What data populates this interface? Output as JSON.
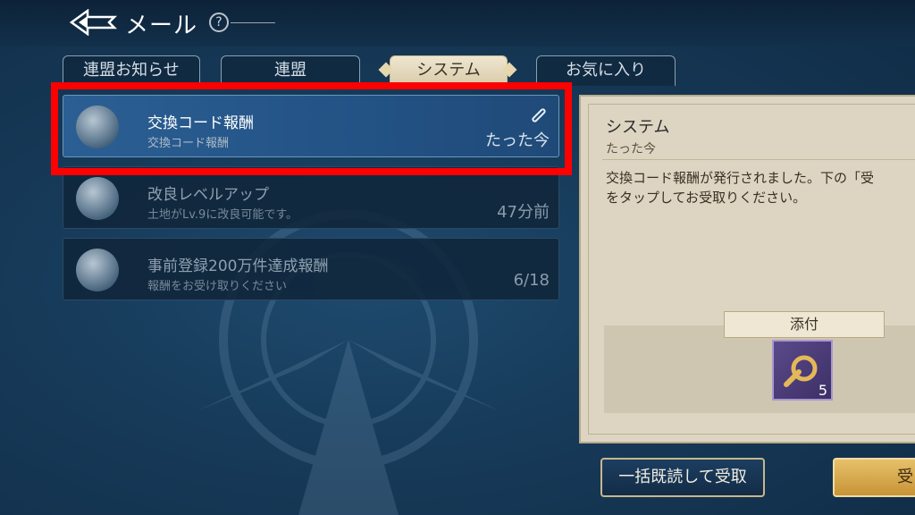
{
  "header": {
    "title": "メール",
    "help_label": "?"
  },
  "tabs": [
    {
      "label": "連盟お知らせ",
      "active": false
    },
    {
      "label": "連盟",
      "active": false
    },
    {
      "label": "システム",
      "active": true
    },
    {
      "label": "お気に入り",
      "active": false
    }
  ],
  "mails": [
    {
      "title": "交換コード報酬",
      "subtitle": "交換コード報酬",
      "time": "たった今",
      "icon": "laurel-bust-icon",
      "has_attachment": true,
      "selected": true
    },
    {
      "title": "改良レベルアップ",
      "subtitle": "土地がLv.9に改良可能です。",
      "time": "47分前",
      "icon": "laurel-globe-icon",
      "has_attachment": false,
      "selected": false
    },
    {
      "title": "事前登録200万件達成報酬",
      "subtitle": "報酬をお受け取りください",
      "time": "6/18",
      "icon": "gm-gear-icon",
      "has_attachment": false,
      "selected": false
    }
  ],
  "detail": {
    "title": "システム",
    "time": "たった今",
    "body_line1": "交換コード報酬が発行されました。下の「受",
    "body_line2": "をタップしてお受取りください。",
    "attachment_label": "添付",
    "attachment_item": {
      "icon": "wrench-gear-icon",
      "count": "5"
    }
  },
  "buttons": {
    "read_all": "一括既読して受取",
    "claim": "受"
  },
  "colors": {
    "highlight": "#ff0000",
    "selected_row": "#2b5f93",
    "panel": "#ddd5c2"
  }
}
